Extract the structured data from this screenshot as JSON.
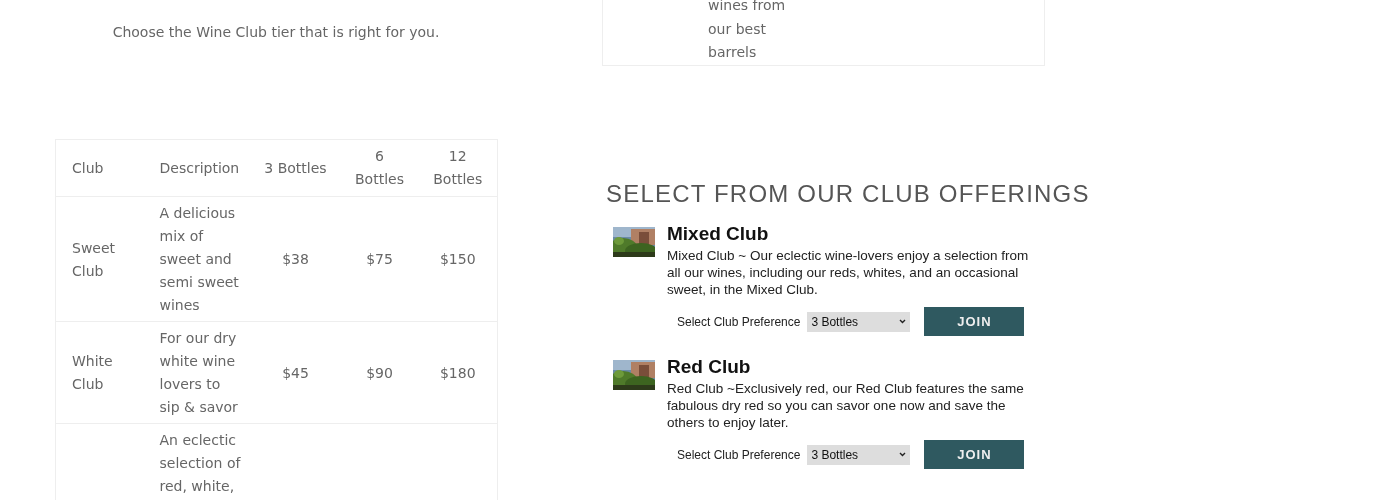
{
  "intro": "Choose the Wine Club tier that is right for you.",
  "pricing_table": {
    "columns": [
      "Club",
      "Description",
      "3 Bottles",
      "6 Bottles",
      "12 Bottles"
    ],
    "rows": [
      {
        "cells": [
          "Sweet Club",
          "A delicious mix of sweet and semi sweet wines",
          "$38",
          "$75",
          "$150"
        ]
      },
      {
        "cells": [
          "White Club",
          "For our dry white wine lovers to sip & savor",
          "$45",
          "$90",
          "$180"
        ]
      },
      {
        "cells": [
          "",
          "An eclectic selection of red, white,",
          "",
          "",
          ""
        ]
      }
    ]
  },
  "top_card": {
    "text": "wines from our best barrels"
  },
  "offerings": {
    "heading": "SELECT FROM OUR CLUB OFFERINGS",
    "clubs": [
      {
        "name": "Mixed Club",
        "description": "Mixed Club ~ Our eclectic wine-lovers enjoy a selection from all our wines, including our reds, whites, and an occasional sweet, in the Mixed Club.",
        "preference_label": "Select Club Preference",
        "preference": "3 Bottles",
        "button": "JOIN"
      },
      {
        "name": "Red Club",
        "description": "Red Club ~Exclusively red, our Red Club features the same fabulous dry red so you can savor one now and save the others to enjoy later.",
        "preference_label": "Select Club Preference",
        "preference": "3 Bottles",
        "button": "JOIN"
      }
    ]
  }
}
